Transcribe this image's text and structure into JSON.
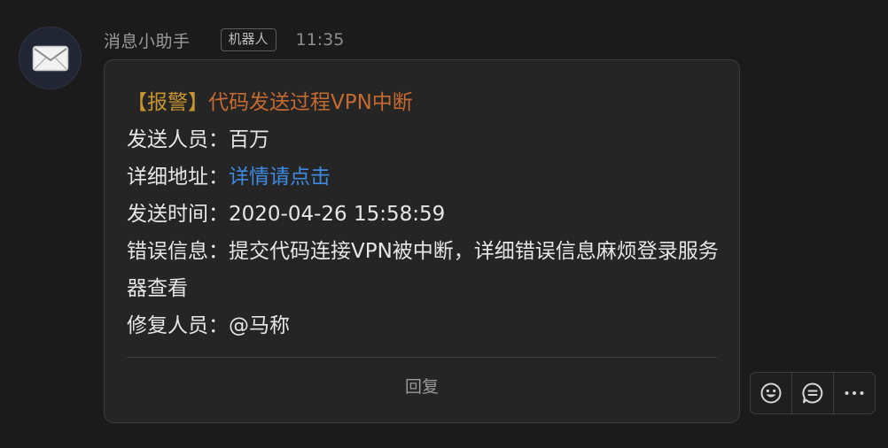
{
  "message": {
    "sender": "消息小助手",
    "badge": "机器人",
    "time": "11:35",
    "avatar_icon": "envelope-icon",
    "card": {
      "title_tag": "【报警】",
      "title_text": "代码发送过程VPN中断",
      "fields": {
        "sender_label": "发送人员：",
        "sender_value": "百万",
        "detail_label": "详细地址：",
        "detail_link": "详情请点击",
        "time_label": "发送时间：",
        "time_value": "2020-04-26 15:58:59",
        "error_label": "错误信息：",
        "error_value": "提交代码连接VPN被中断，详细错误信息麻烦登录服务器查看",
        "fixer_label": "修复人员：",
        "fixer_value": "@马称"
      },
      "reply_label": "回复"
    }
  },
  "actions": [
    {
      "icon": "emoji-icon"
    },
    {
      "icon": "comment-icon"
    },
    {
      "icon": "more-icon"
    }
  ],
  "colors": {
    "background": "#1b1b1b",
    "card_background": "#252525",
    "title_tag": "#c9952e",
    "title": "#c56a30",
    "link": "#3d8ae0"
  }
}
